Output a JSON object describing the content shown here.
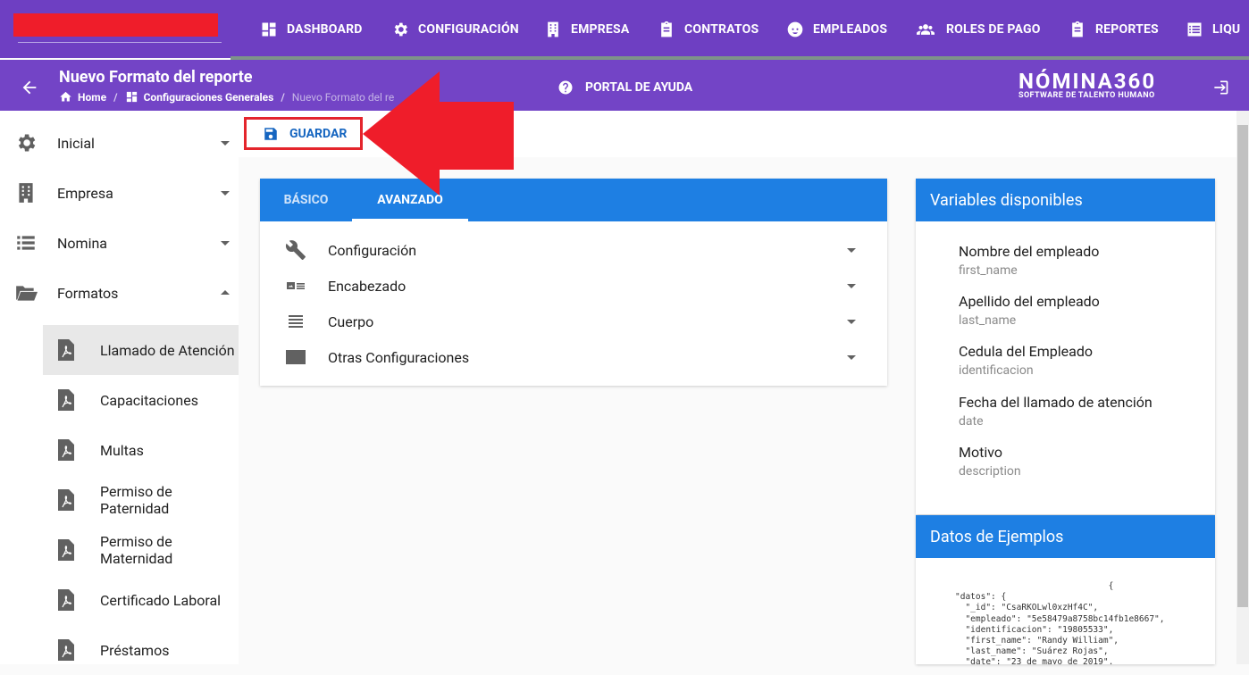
{
  "nav": {
    "items": [
      {
        "label": "DASHBOARD",
        "icon": "dashboard-icon"
      },
      {
        "label": "CONFIGURACIÓN",
        "icon": "gear-icon"
      },
      {
        "label": "EMPRESA",
        "icon": "building-icon"
      },
      {
        "label": "CONTRATOS",
        "icon": "clipboard-icon"
      },
      {
        "label": "EMPLEADOS",
        "icon": "face-icon"
      },
      {
        "label": "ROLES DE PAGO",
        "icon": "group-icon"
      },
      {
        "label": "REPORTES",
        "icon": "clipboard-icon"
      },
      {
        "label": "LIQU",
        "icon": "list-icon"
      }
    ]
  },
  "header": {
    "title": "Nuevo Formato del reporte",
    "breadcrumb": [
      "Home",
      "Configuraciones Generales",
      "Nuevo Formato del re"
    ],
    "help": "PORTAL DE AYUDA",
    "brand": "NÓMINA360",
    "brand_sub": "SOFTWARE DE TALENTO HUMANO"
  },
  "sidebar": {
    "items": [
      {
        "label": "Inicial",
        "icon": "gear-icon",
        "expanded": false
      },
      {
        "label": "Empresa",
        "icon": "building-icon",
        "expanded": false
      },
      {
        "label": "Nomina",
        "icon": "list-icon",
        "expanded": false
      },
      {
        "label": "Formatos",
        "icon": "folder-open-icon",
        "expanded": true
      }
    ],
    "subitems": [
      {
        "label": "Llamado de Atención",
        "active": true
      },
      {
        "label": "Capacitaciones"
      },
      {
        "label": "Multas"
      },
      {
        "label": "Permiso de Paternidad"
      },
      {
        "label": "Permiso de Maternidad"
      },
      {
        "label": "Certificado Laboral"
      },
      {
        "label": "Préstamos"
      }
    ]
  },
  "toolbar": {
    "save_label": "GUARDAR"
  },
  "editor": {
    "tabs": [
      {
        "label": "BÁSICO",
        "active": false
      },
      {
        "label": "AVANZADO",
        "active": true
      }
    ],
    "sections": [
      {
        "label": "Configuración",
        "icon": "wrench-icon"
      },
      {
        "label": "Encabezado",
        "icon": "id-card-icon"
      },
      {
        "label": "Cuerpo",
        "icon": "text-lines-icon"
      },
      {
        "label": "Otras Configuraciones",
        "icon": "panel-icon"
      }
    ]
  },
  "variables": {
    "title": "Variables disponibles",
    "items": [
      {
        "name": "Nombre del empleado",
        "key": "first_name"
      },
      {
        "name": "Apellido del empleado",
        "key": "last_name"
      },
      {
        "name": "Cedula del Empleado",
        "key": "identificacion"
      },
      {
        "name": "Fecha del llamado de atención",
        "key": "date"
      },
      {
        "name": "Motivo",
        "key": "description"
      }
    ]
  },
  "examples": {
    "title": "Datos de Ejemplos",
    "code": "                              {\n\"datos\": {\n  \"_id\": \"CsaRKOLwl0xzHf4C\",\n  \"empleado\": \"5e58479a8758bc14fb1e8667\",\n  \"identificacion\": \"19805533\",\n  \"first_name\": \"Randy William\",\n  \"last_name\": \"Suárez Rojas\",\n  \"date\": \"23 de mayo de 2019\","
  },
  "colors": {
    "primary": "#6e3fc2",
    "accent_blue": "#1e7fe3",
    "highlight_red": "#ef1d2a"
  }
}
